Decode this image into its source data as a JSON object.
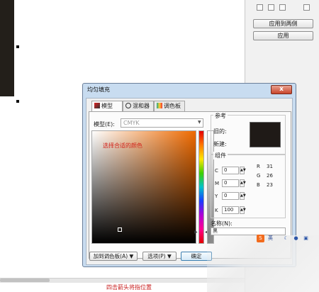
{
  "docker": {
    "apply_to_both_label": "应用到两侧",
    "apply_label": "应用"
  },
  "dialog": {
    "title": "均匀填充",
    "close_glyph": "x",
    "tabs": [
      {
        "label": "模型",
        "icon": "model-icon"
      },
      {
        "label": "混和器",
        "icon": "mixer-icon"
      },
      {
        "label": "调色板",
        "icon": "palette-icon"
      }
    ],
    "model_label": "模型(E):",
    "model_value": "CMYK",
    "picker_hint": "选择合适的颜色",
    "reference": {
      "title": "参考",
      "old_label": "旧的:",
      "new_label": "新建:",
      "swatch_color": "#1f1a17"
    },
    "components": {
      "title": "组件",
      "cmyk": [
        {
          "label": "C",
          "value": "0"
        },
        {
          "label": "M",
          "value": "0"
        },
        {
          "label": "Y",
          "value": "0"
        },
        {
          "label": "K",
          "value": "100"
        }
      ],
      "rgb": [
        {
          "label": "R",
          "value": "31"
        },
        {
          "label": "G",
          "value": "26"
        },
        {
          "label": "B",
          "value": "23"
        }
      ]
    },
    "name_label": "名称(N):",
    "name_value": "黑",
    "buttons": {
      "add_palette": "加到调色板(A) ▼",
      "options": "选项(P) ▼",
      "ok": "确定"
    }
  },
  "status": {
    "text": "四击箭头将指位置"
  },
  "ime": {
    "icon_s": "S",
    "icon_zh": "英"
  }
}
